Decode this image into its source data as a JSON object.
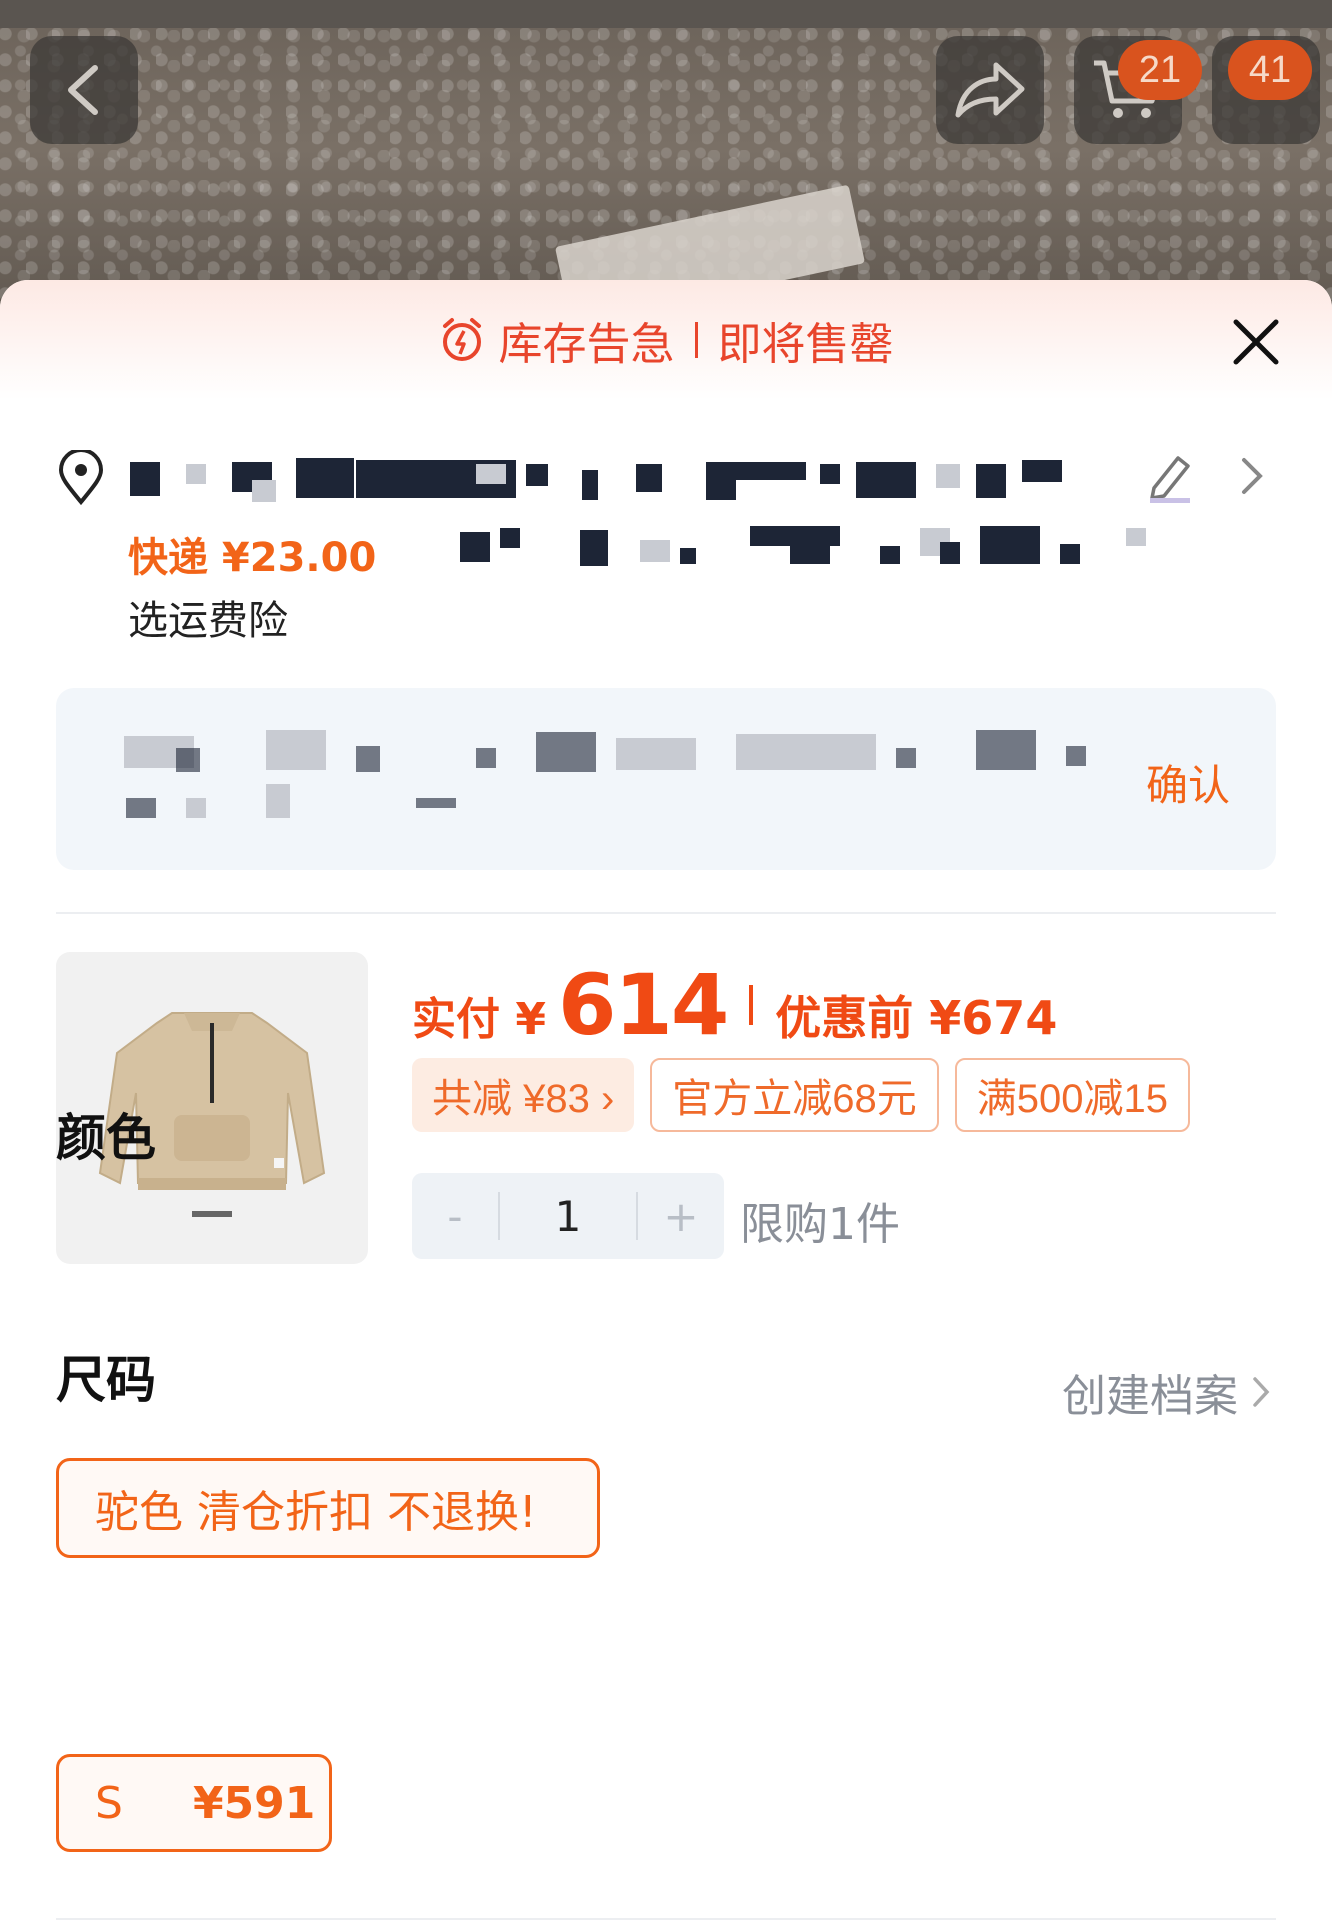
{
  "header": {
    "cart_count": "21",
    "messages_count": "41"
  },
  "banner": {
    "stock_label": "库存告急",
    "sellout_label": "即将售罄"
  },
  "shipping": {
    "express_label": "快递 ¥23.00",
    "insurance_label": "选运费险"
  },
  "notice": {
    "confirm_label": "确认"
  },
  "product": {
    "pay_label": "实付 ¥",
    "pay_price": "614",
    "before_label": "优惠前 ¥674",
    "discount_chip": "共减 ¥83 ›",
    "chip_official": "官方立减68元",
    "chip_threshold": "满500减15",
    "quantity": "1",
    "minus": "-",
    "plus": "+",
    "limit_text": "限购1件"
  },
  "color_section": {
    "title": "颜色",
    "option": "驼色 清仓折扣 不退换!"
  },
  "size_section": {
    "title": "尺码",
    "profile_link": "创建档案",
    "option_size": "S",
    "option_price": "¥591"
  },
  "colors": {
    "accent": "#f26418",
    "alert_red": "#e8452c",
    "price_red": "#f04a14"
  }
}
